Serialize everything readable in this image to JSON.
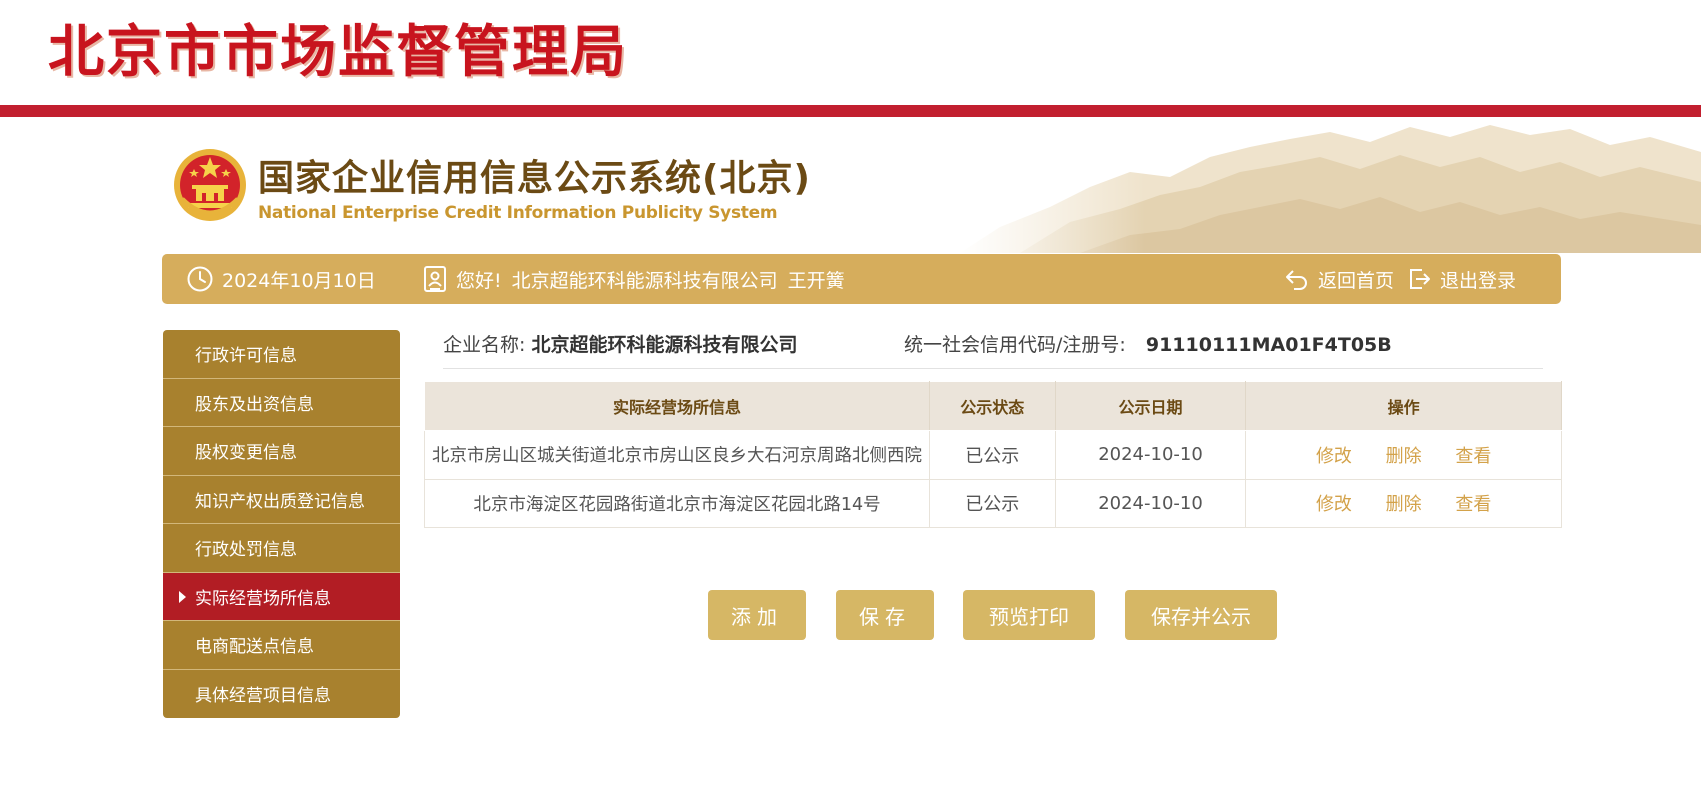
{
  "header": {
    "bureau_title": "北京市市场监督管理局"
  },
  "banner": {
    "title": "国家企业信用信息公示系统(北京)",
    "subtitle": "National Enterprise Credit Information Publicity System"
  },
  "infobar": {
    "date": "2024年10月10日",
    "greeting": "您好!",
    "company": "北京超能环科能源科技有限公司",
    "user": "王开簧",
    "home_label": "返回首页",
    "logout_label": "退出登录"
  },
  "sidebar": {
    "items": [
      {
        "label": "行政许可信息"
      },
      {
        "label": "股东及出资信息"
      },
      {
        "label": "股权变更信息"
      },
      {
        "label": "知识产权出质登记信息"
      },
      {
        "label": "行政处罚信息"
      },
      {
        "label": "实际经营场所信息",
        "active": true
      },
      {
        "label": "电商配送点信息"
      },
      {
        "label": "具体经营项目信息"
      }
    ]
  },
  "company": {
    "name_label": "企业名称:",
    "name": "北京超能环科能源科技有限公司",
    "code_label": "统一社会信用代码/注册号:",
    "code": "91110111MA01F4T05B"
  },
  "table": {
    "headers": [
      "实际经营场所信息",
      "公示状态",
      "公示日期",
      "操作"
    ],
    "rows": [
      {
        "address": "北京市房山区城关街道北京市房山区良乡大石河京周路北侧西院",
        "status": "已公示",
        "date": "2024-10-10"
      },
      {
        "address": "北京市海淀区花园路街道北京市海淀区花园北路14号",
        "status": "已公示",
        "date": "2024-10-10"
      }
    ],
    "actions": {
      "edit": "修改",
      "delete": "删除",
      "view": "查看"
    }
  },
  "buttons": {
    "add": "添加",
    "save": "保存",
    "preview": "预览打印",
    "publish": "保存并公示"
  },
  "colors": {
    "brand_red": "#c21f2f",
    "gold": "#d6ad5c",
    "sidebar": "#a8812e",
    "sidebar_active": "#b21d24"
  }
}
